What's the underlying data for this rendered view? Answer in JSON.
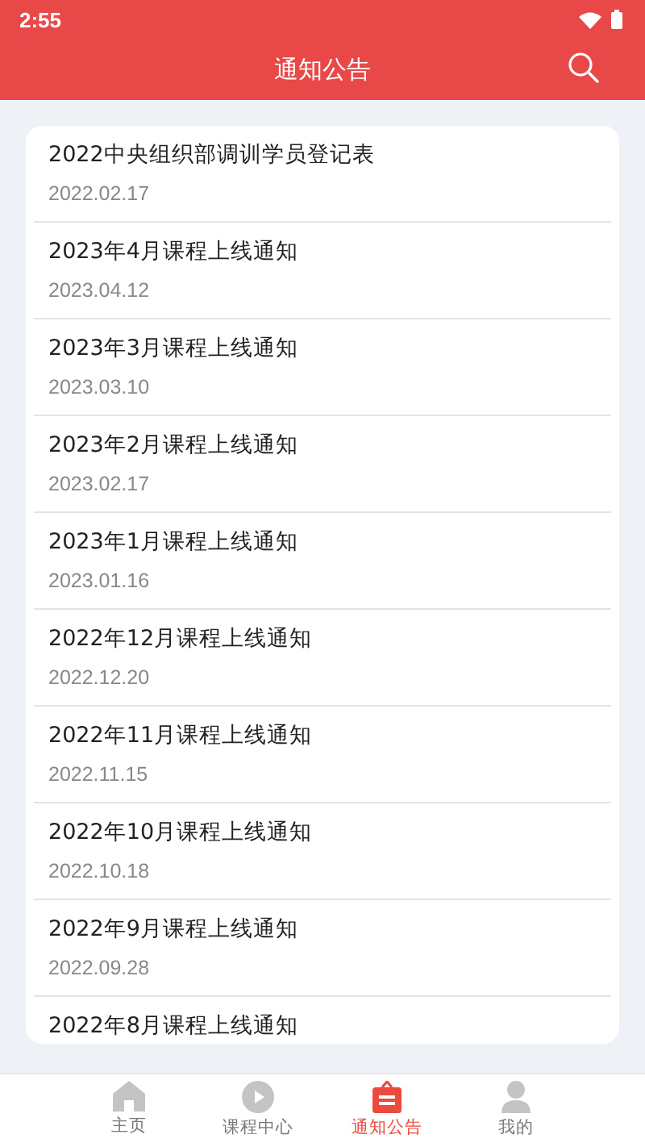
{
  "status_bar": {
    "time": "2:55"
  },
  "app_bar": {
    "title": "通知公告"
  },
  "notices": [
    {
      "title": "2022中央组织部调训学员登记表",
      "date": "2022.02.17"
    },
    {
      "title": "2023年4月课程上线通知",
      "date": "2023.04.12"
    },
    {
      "title": "2023年3月课程上线通知",
      "date": "2023.03.10"
    },
    {
      "title": "2023年2月课程上线通知",
      "date": "2023.02.17"
    },
    {
      "title": "2023年1月课程上线通知",
      "date": "2023.01.16"
    },
    {
      "title": "2022年12月课程上线通知",
      "date": "2022.12.20"
    },
    {
      "title": "2022年11月课程上线通知",
      "date": "2022.11.15"
    },
    {
      "title": "2022年10月课程上线通知",
      "date": "2022.10.18"
    },
    {
      "title": "2022年9月课程上线通知",
      "date": "2022.09.28"
    },
    {
      "title": "2022年8月课程上线通知"
    }
  ],
  "bottom_nav": [
    {
      "kind": "home",
      "label": "主页",
      "selected": false
    },
    {
      "kind": "play",
      "label": "课程中心",
      "selected": false
    },
    {
      "kind": "notice",
      "label": "通知公告",
      "selected": true
    },
    {
      "kind": "profile",
      "label": "我的",
      "selected": false
    }
  ]
}
